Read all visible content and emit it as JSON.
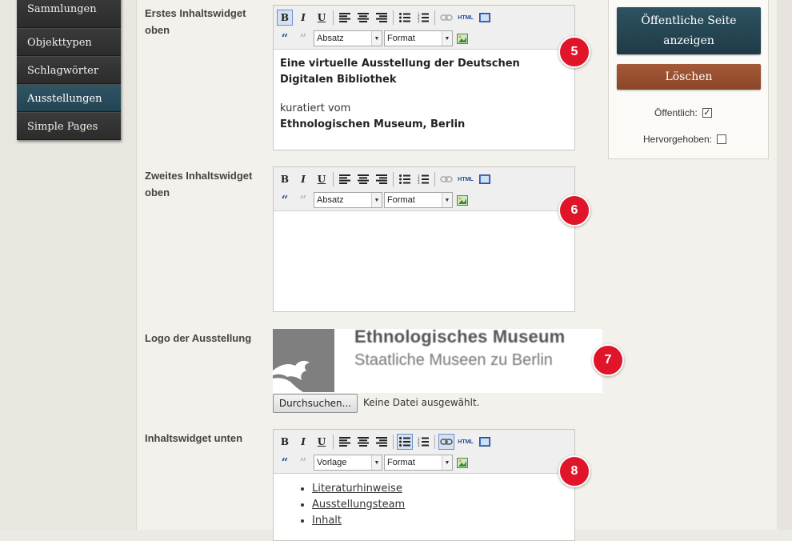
{
  "nav": {
    "items": [
      {
        "label": "Sammlungen"
      },
      {
        "label": "Objekttypen"
      },
      {
        "label": "Schlagwörter"
      },
      {
        "label": "Ausstellungen"
      },
      {
        "label": "Simple Pages"
      }
    ]
  },
  "fields": {
    "widget1_label": "Erstes Inhaltswidget oben",
    "widget2_label": "Zweites Inhaltswidget oben",
    "logo_label": "Logo der Ausstellung",
    "widget3_label": "Inhaltswidget unten"
  },
  "editors": {
    "e1": {
      "format1": "Absatz",
      "format2": "Format",
      "title": "Eine virtuelle Ausstellung der Deutschen Digitalen Bibliothek",
      "line1": "kuratiert vom",
      "line2": "Ethnologischen Museum, Berlin"
    },
    "e2": {
      "format1": "Absatz",
      "format2": "Format"
    },
    "e3": {
      "format1": "Vorlage",
      "format2": "Format",
      "list": [
        "Literaturhinweise",
        "Ausstellungsteam",
        "Inhalt"
      ]
    }
  },
  "toolbar": {
    "bold": "B",
    "italic": "I",
    "underline": "U",
    "html": "HTML",
    "quote_open": "66",
    "quote_close": "99"
  },
  "logo": {
    "line1": "Ethnologisches Museum",
    "line2": "Staatliche Museen zu Berlin"
  },
  "file": {
    "button": "Durchsuchen...",
    "status": "Keine Datei ausgewählt."
  },
  "badges": {
    "b5": "5",
    "b6": "6",
    "b7": "7",
    "b8": "8"
  },
  "panel": {
    "view_button": "Öffentliche Seite anzeigen",
    "delete_button": "Löschen",
    "public_label": "Öffentlich:",
    "public_checked": true,
    "featured_label": "Hervorgehoben:",
    "featured_checked": false
  },
  "colors": {
    "accent": "#1f3a46",
    "delete": "#8b4528",
    "badge": "#e0152a",
    "nav_active": "#244452"
  }
}
